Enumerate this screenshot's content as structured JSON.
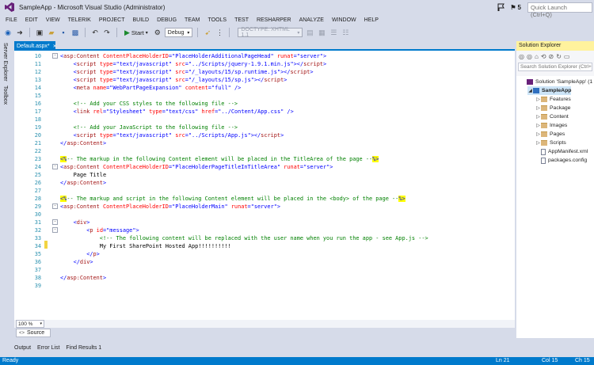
{
  "window": {
    "title": "SampleApp - Microsoft Visual Studio (Administrator)",
    "notification_count": "5",
    "quick_launch_placeholder": "Quick Launch (Ctrl+Q)"
  },
  "menu": [
    "FILE",
    "EDIT",
    "VIEW",
    "TELERIK",
    "PROJECT",
    "BUILD",
    "DEBUG",
    "TEAM",
    "TOOLS",
    "TEST",
    "RESHARPER",
    "ANALYZE",
    "WINDOW",
    "HELP"
  ],
  "toolbar": {
    "start_label": "Start",
    "config_value": "Debug",
    "doctype_value": "DOCTYPE: XHTML 1.1"
  },
  "left_tabs": {
    "server_explorer": "Server Explorer",
    "toolbox": "Toolbox"
  },
  "editor": {
    "tab_label": "Default.aspx*",
    "lines": [
      {
        "n": "10",
        "fold": "-",
        "html": "<span class='br'>&lt;</span><span class='tag'>asp:Content</span> <span class='attr'>ContentPlaceHolderID</span><span class='br'>=</span><span class='val'>\"PlaceHolderAdditionalPageHead\"</span> <span class='attr'>runat</span><span class='br'>=</span><span class='val'>\"server\"</span><span class='br'>&gt;</span>"
      },
      {
        "n": "11",
        "fold": "",
        "html": "    <span class='br'>&lt;</span><span class='tag'>script</span> <span class='attr'>type</span><span class='br'>=</span><span class='val'>\"text/javascript\"</span> <span class='attr'>src</span><span class='br'>=</span><span class='val'>\"../Scripts/jquery-1.9.1.min.js\"</span><span class='br'>&gt;&lt;/</span><span class='tag'>script</span><span class='br'>&gt;</span>"
      },
      {
        "n": "12",
        "fold": "",
        "html": "    <span class='br'>&lt;</span><span class='tag'>script</span> <span class='attr'>type</span><span class='br'>=</span><span class='val'>\"text/javascript\"</span> <span class='attr'>src</span><span class='br'>=</span><span class='val'>\"/_layouts/15/sp.runtime.js\"</span><span class='br'>&gt;&lt;/</span><span class='tag'>script</span><span class='br'>&gt;</span>"
      },
      {
        "n": "13",
        "fold": "",
        "html": "    <span class='br'>&lt;</span><span class='tag'>script</span> <span class='attr'>type</span><span class='br'>=</span><span class='val'>\"text/javascript\"</span> <span class='attr'>src</span><span class='br'>=</span><span class='val'>\"/_layouts/15/sp.js\"</span><span class='br'>&gt;&lt;/</span><span class='tag'>script</span><span class='br'>&gt;</span>"
      },
      {
        "n": "14",
        "fold": "",
        "html": "    <span class='br'>&lt;</span><span class='tag'>meta</span> <span class='attr'>name</span><span class='br'>=</span><span class='val'>\"WebPartPageExpansion\"</span> <span class='attr'>content</span><span class='br'>=</span><span class='val'>\"full\"</span> <span class='br'>/&gt;</span>"
      },
      {
        "n": "15",
        "fold": "",
        "html": ""
      },
      {
        "n": "16",
        "fold": "",
        "html": "    <span class='cm'>&lt;!-- Add your CSS styles to the following file --&gt;</span>"
      },
      {
        "n": "17",
        "fold": "",
        "html": "    <span class='br'>&lt;</span><span class='tag'>link</span> <span class='attr'>rel</span><span class='br'>=</span><span class='val'>\"Stylesheet\"</span> <span class='attr'>type</span><span class='br'>=</span><span class='val'>\"text/css\"</span> <span class='attr'>href</span><span class='br'>=</span><span class='val'>\"../Content/App.css\"</span> <span class='br'>/&gt;</span>"
      },
      {
        "n": "18",
        "fold": "",
        "html": ""
      },
      {
        "n": "19",
        "fold": "",
        "html": "    <span class='cm'>&lt;!-- Add your JavaScript to the following file --&gt;</span>"
      },
      {
        "n": "20",
        "fold": "",
        "html": "    <span class='br'>&lt;</span><span class='tag'>script</span> <span class='attr'>type</span><span class='br'>=</span><span class='val'>\"text/javascript\"</span> <span class='attr'>src</span><span class='br'>=</span><span class='val'>\"../Scripts/App.js\"</span><span class='br'>&gt;&lt;/</span><span class='tag'>script</span><span class='br'>&gt;</span>"
      },
      {
        "n": "21",
        "fold": "",
        "html": "<span class='br'>&lt;/</span><span class='tag'>asp:Content</span><span class='br'>&gt;</span>"
      },
      {
        "n": "22",
        "fold": "",
        "html": ""
      },
      {
        "n": "23",
        "fold": "",
        "html": "<span class='hl'>&lt;%</span><span class='cm'>-- The markup in the following Content element will be placed in the TitleArea of the page --</span><span class='hl'>%&gt;</span>"
      },
      {
        "n": "24",
        "fold": "-",
        "html": "<span class='br'>&lt;</span><span class='tag'>asp:Content</span> <span class='attr'>ContentPlaceHolderID</span><span class='br'>=</span><span class='val'>\"PlaceHolderPageTitleInTitleArea\"</span> <span class='attr'>runat</span><span class='br'>=</span><span class='val'>\"server\"</span><span class='br'>&gt;</span>"
      },
      {
        "n": "25",
        "fold": "",
        "html": "    <span class='txt'>Page Title</span>"
      },
      {
        "n": "26",
        "fold": "",
        "html": "<span class='br'>&lt;/</span><span class='tag'>asp:Content</span><span class='br'>&gt;</span>"
      },
      {
        "n": "27",
        "fold": "",
        "html": ""
      },
      {
        "n": "28",
        "fold": "",
        "html": "<span class='hl'>&lt;%</span><span class='cm'>-- The markup and script in the following Content element will be placed in the &lt;body&gt; of the page --</span><span class='hl'>%&gt;</span>"
      },
      {
        "n": "29",
        "fold": "-",
        "html": "<span class='br'>&lt;</span><span class='tag'>asp:Content</span> <span class='attr'>ContentPlaceHolderID</span><span class='br'>=</span><span class='val'>\"PlaceHolderMain\"</span> <span class='attr'>runat</span><span class='br'>=</span><span class='val'>\"server\"</span><span class='br'>&gt;</span>"
      },
      {
        "n": "30",
        "fold": "",
        "html": ""
      },
      {
        "n": "31",
        "fold": "-",
        "html": "    <span class='br'>&lt;</span><span class='tag'>div</span><span class='br'>&gt;</span>"
      },
      {
        "n": "32",
        "fold": "-",
        "html": "        <span class='br'>&lt;</span><span class='tag'>p</span> <span class='attr'>id</span><span class='br'>=</span><span class='val'>\"message\"</span><span class='br'>&gt;</span>"
      },
      {
        "n": "33",
        "fold": "",
        "html": "            <span class='cm'>&lt;!-- The following content will be replaced with the user name when you run the app - see App.js --&gt;</span>"
      },
      {
        "n": "34",
        "fold": "",
        "html": "            <span class='txt'>My First SharePoint Hosted App!!!!!!!!!!</span>"
      },
      {
        "n": "35",
        "fold": "",
        "html": "        <span class='br'>&lt;/</span><span class='tag'>p</span><span class='br'>&gt;</span>"
      },
      {
        "n": "36",
        "fold": "",
        "html": "    <span class='br'>&lt;/</span><span class='tag'>div</span><span class='br'>&gt;</span>"
      },
      {
        "n": "37",
        "fold": "",
        "html": ""
      },
      {
        "n": "38",
        "fold": "",
        "html": "<span class='br'>&lt;/</span><span class='tag'>asp:Content</span><span class='br'>&gt;</span>"
      },
      {
        "n": "39",
        "fold": "",
        "html": ""
      }
    ],
    "zoom": "100 %",
    "view_tab": "Source"
  },
  "solution_explorer": {
    "title": "Solution Explorer",
    "search_placeholder": "Search Solution Explorer (Ctrl+;)",
    "items": [
      {
        "label": "Solution 'SampleApp' (1 project)",
        "icon": "solution-icon",
        "arrow": ""
      },
      {
        "label": "SampleApp",
        "icon": "project-icon",
        "arrow": "◢"
      },
      {
        "label": "Features",
        "icon": "folder-icon",
        "arrow": "▷"
      },
      {
        "label": "Package",
        "icon": "folder-icon",
        "arrow": "▷"
      },
      {
        "label": "Content",
        "icon": "folder-icon",
        "arrow": "▷"
      },
      {
        "label": "Images",
        "icon": "folder-icon",
        "arrow": "▷"
      },
      {
        "label": "Pages",
        "icon": "folder-icon",
        "arrow": "▷"
      },
      {
        "label": "Scripts",
        "icon": "folder-icon",
        "arrow": "▷"
      },
      {
        "label": "AppManifest.xml",
        "icon": "file-icon",
        "arrow": ""
      },
      {
        "label": "packages.config",
        "icon": "file-icon",
        "arrow": ""
      }
    ]
  },
  "bottom_tabs": [
    "Output",
    "Error List",
    "Find Results 1"
  ],
  "status": {
    "ready": "Ready",
    "ln": "Ln 21",
    "col": "Col 15",
    "ch": "Ch 15"
  }
}
